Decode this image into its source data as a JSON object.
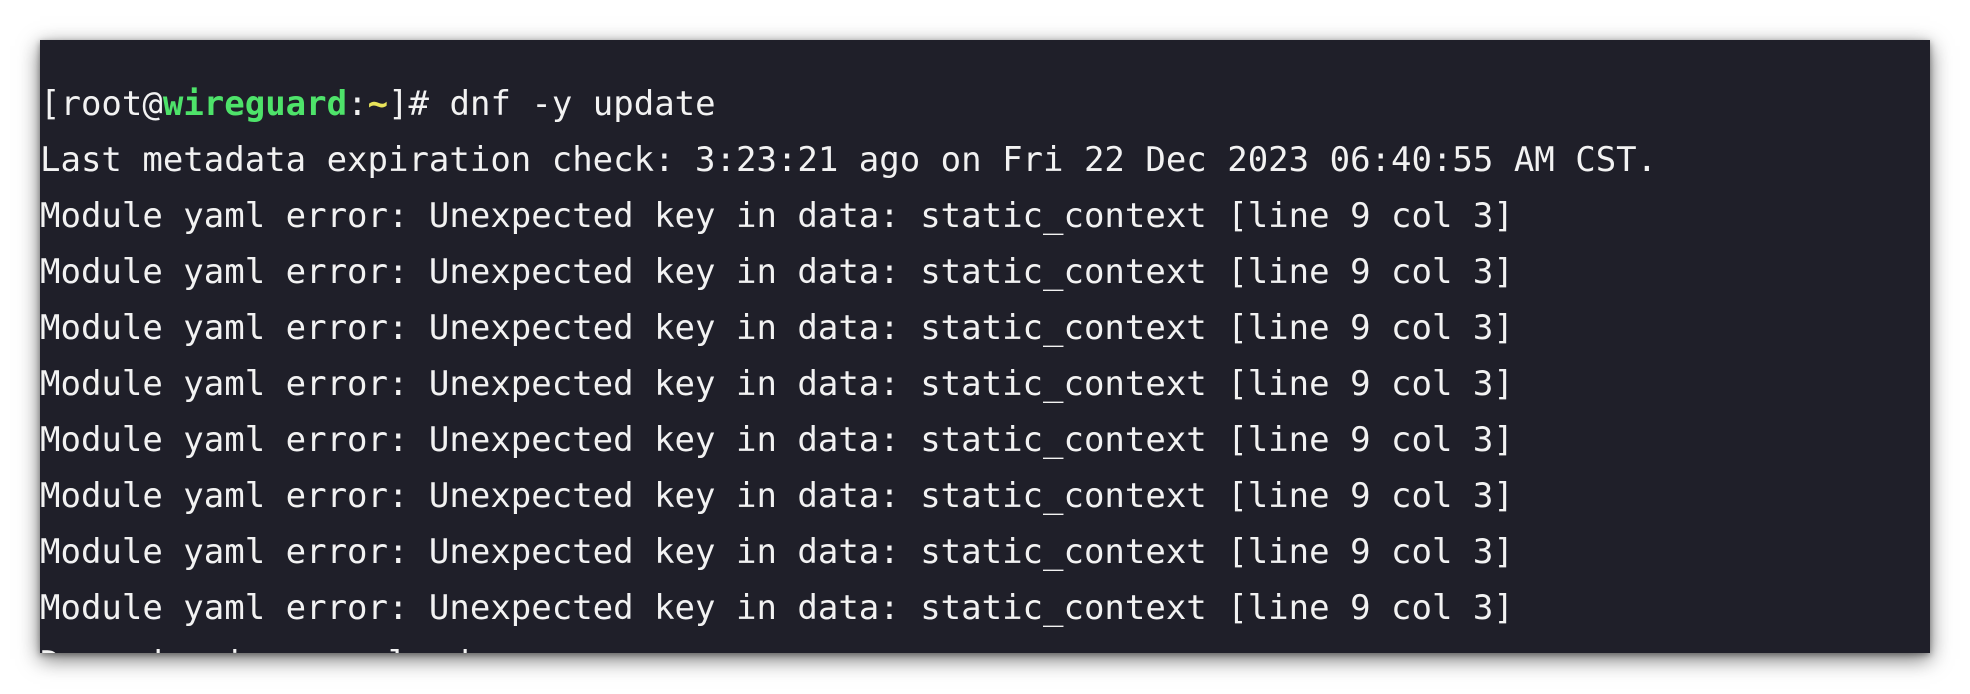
{
  "terminal": {
    "prompt": {
      "open_bracket": "[",
      "user": "root",
      "at": "@",
      "host": "wireguard",
      "colon": ":",
      "path": "~",
      "close_bracket": "]",
      "symbol": "# ",
      "command": "dnf -y update"
    },
    "output_lines": [
      "Last metadata expiration check: 3:23:21 ago on Fri 22 Dec 2023 06:40:55 AM CST.",
      "Module yaml error: Unexpected key in data: static_context [line 9 col 3]",
      "Module yaml error: Unexpected key in data: static_context [line 9 col 3]",
      "Module yaml error: Unexpected key in data: static_context [line 9 col 3]",
      "Module yaml error: Unexpected key in data: static_context [line 9 col 3]",
      "Module yaml error: Unexpected key in data: static_context [line 9 col 3]",
      "Module yaml error: Unexpected key in data: static_context [line 9 col 3]",
      "Module yaml error: Unexpected key in data: static_context [line 9 col 3]",
      "Module yaml error: Unexpected key in data: static_context [line 9 col 3]",
      "Dependencies resolved."
    ],
    "colors": {
      "background": "#1f1f29",
      "text": "#f2f2f2",
      "host": "#4ee36a",
      "path": "#e8e35a"
    }
  }
}
